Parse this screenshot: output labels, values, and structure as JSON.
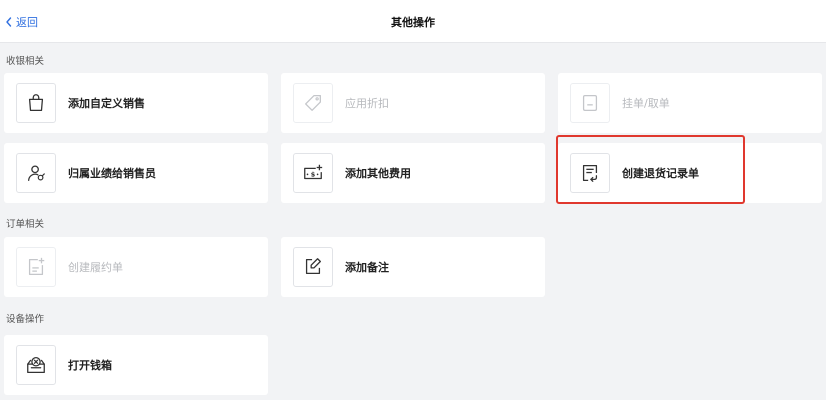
{
  "header": {
    "back_label": "返回",
    "title": "其他操作"
  },
  "sections": {
    "cashier": {
      "label": "收银相关",
      "items": [
        {
          "label": "添加自定义销售",
          "icon": "shopping-bag-icon",
          "disabled": false
        },
        {
          "label": "应用折扣",
          "icon": "tag-icon",
          "disabled": true
        },
        {
          "label": "挂单/取单",
          "icon": "document-icon",
          "disabled": true
        },
        {
          "label": "归属业绩给销售员",
          "icon": "user-assign-icon",
          "disabled": false
        },
        {
          "label": "添加其他费用",
          "icon": "add-fee-icon",
          "disabled": false
        },
        {
          "label": "创建退货记录单",
          "icon": "return-record-icon",
          "disabled": false
        }
      ]
    },
    "order": {
      "label": "订单相关",
      "items": [
        {
          "label": "创建履约单",
          "icon": "add-document-icon",
          "disabled": true
        },
        {
          "label": "添加备注",
          "icon": "edit-note-icon",
          "disabled": false
        }
      ]
    },
    "device": {
      "label": "设备操作",
      "items": [
        {
          "label": "打开钱箱",
          "icon": "cash-drawer-icon",
          "disabled": false
        }
      ]
    }
  },
  "colors": {
    "accent": "#2f6fe0",
    "highlight": "#e0382e",
    "background": "#f2f3f5",
    "disabled_text": "#b7b9bd"
  }
}
